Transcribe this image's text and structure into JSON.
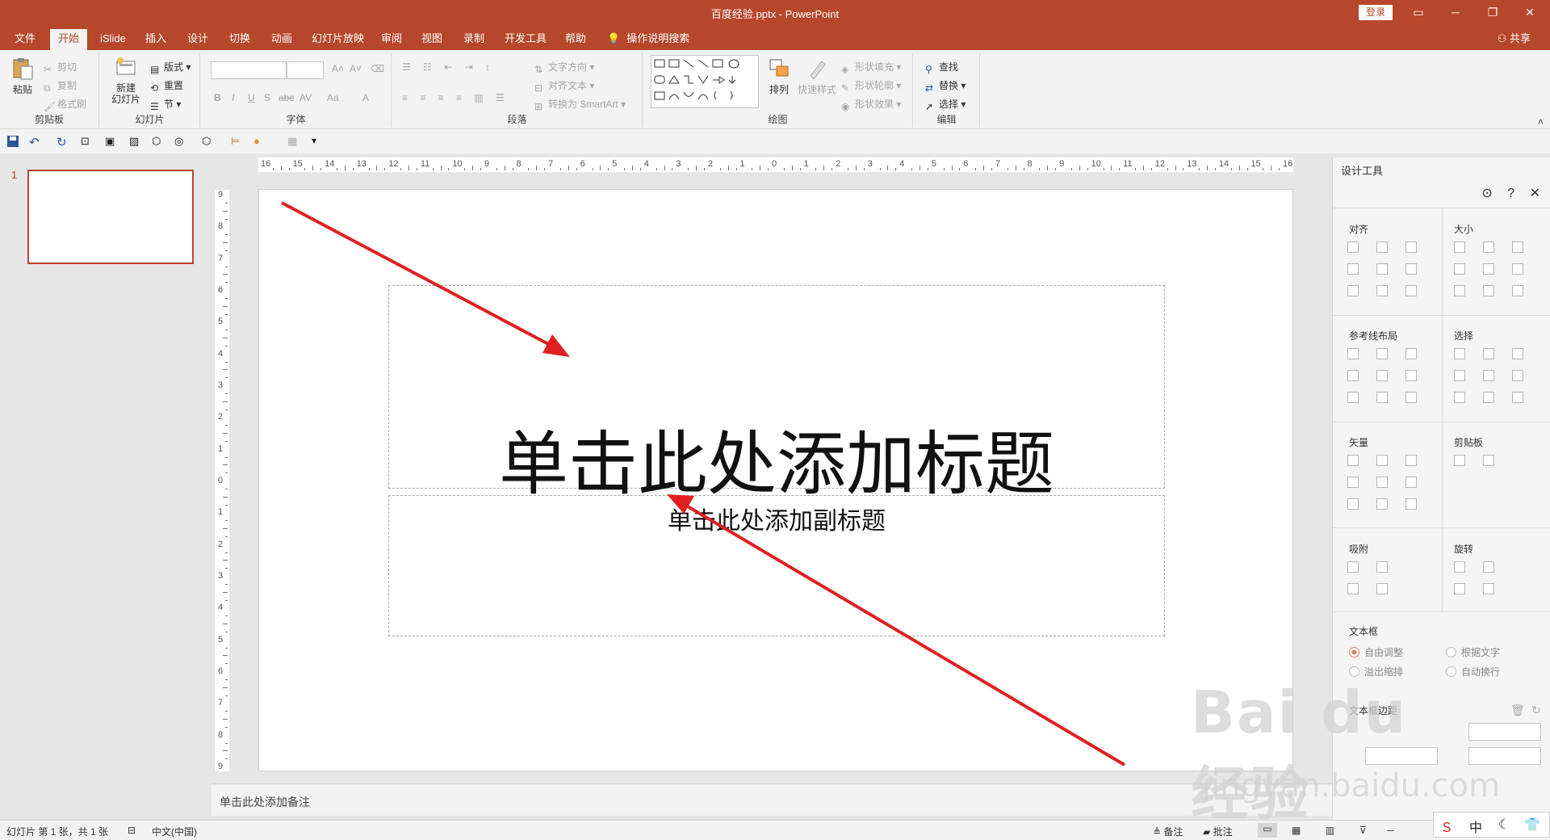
{
  "titlebar": {
    "title": "百度经验.pptx  -  PowerPoint",
    "login": "登录",
    "icons": [
      "ribbon-display-icon",
      "minimize-icon",
      "restore-icon",
      "close-icon"
    ]
  },
  "menu": {
    "tabs": [
      "文件",
      "开始",
      "iSlide",
      "插入",
      "设计",
      "切换",
      "动画",
      "幻灯片放映",
      "审阅",
      "视图",
      "录制",
      "开发工具",
      "帮助"
    ],
    "active": "开始",
    "search": "操作说明搜索",
    "share": "共享"
  },
  "ribbon": {
    "clipboard": {
      "paste": "粘贴",
      "cut": "剪切",
      "copy": "复制",
      "format_painter": "格式刷",
      "label": "剪贴板"
    },
    "slides": {
      "new_slide_line1": "新建",
      "new_slide_line2": "幻灯片",
      "layout": "版式",
      "reset": "重置",
      "section": "节",
      "label": "幻灯片"
    },
    "font": {
      "label": "字体",
      "bold": "B",
      "italic": "I",
      "underline": "U",
      "strike": "S",
      "abc": "abc",
      "spacing": "AV",
      "case": "Aa",
      "color": "A",
      "grow": "A˄",
      "shrink": "A˅"
    },
    "paragraph": {
      "label": "段落",
      "text_direction": "文字方向",
      "align_text": "对齐文本",
      "smartart": "转换为 SmartArt"
    },
    "drawing": {
      "label": "绘图",
      "arrange": "排列",
      "quick_styles": "快速样式",
      "fill": "形状填充",
      "outline": "形状轮廓",
      "effects": "形状效果"
    },
    "editing": {
      "label": "编辑",
      "find": "查找",
      "replace": "替换",
      "select": "选择"
    }
  },
  "thumbnail": {
    "number": "1"
  },
  "ruler": {
    "h_labels": [
      "16",
      "15",
      "14",
      "13",
      "12",
      "11",
      "10",
      "9",
      "8",
      "7",
      "6",
      "5",
      "4",
      "3",
      "2",
      "1",
      "0",
      "1",
      "2",
      "3",
      "4",
      "5",
      "6",
      "7",
      "8",
      "9",
      "10",
      "11",
      "12",
      "13",
      "14",
      "15",
      "16"
    ],
    "v_labels": [
      "9",
      "8",
      "7",
      "6",
      "5",
      "4",
      "3",
      "2",
      "1",
      "0",
      "1",
      "2",
      "3",
      "4",
      "5",
      "6",
      "7",
      "8",
      "9"
    ]
  },
  "slide": {
    "title_placeholder": "单击此处添加标题",
    "subtitle_placeholder": "单击此处添加副标题"
  },
  "notes": {
    "placeholder": "单击此处添加备注"
  },
  "design_pane": {
    "title": "设计工具",
    "sections": {
      "align": "对齐",
      "size": "大小",
      "guides": "参考线布局",
      "select": "选择",
      "vector": "矢量",
      "clipboard": "剪贴板",
      "snap": "吸附",
      "rotate": "旋转",
      "textbox": "文本框",
      "textbox_margin": "文本框边距"
    },
    "textbox_options": {
      "autofit": "自由调整",
      "resize_to_text": "根据文字",
      "overflow": "溢出缩排",
      "wrap": "自动换行"
    }
  },
  "status": {
    "slide_info": "幻灯片 第 1 张，共 1 张",
    "language": "中文(中国)",
    "notes": "备注",
    "comments": "批注"
  },
  "watermark": {
    "logo": "Bai du 经验",
    "url": "jingyan.baidu.com"
  },
  "ime": {
    "mode": "中"
  },
  "colors": {
    "accent": "#b7472a",
    "arrow": "#e02020"
  }
}
